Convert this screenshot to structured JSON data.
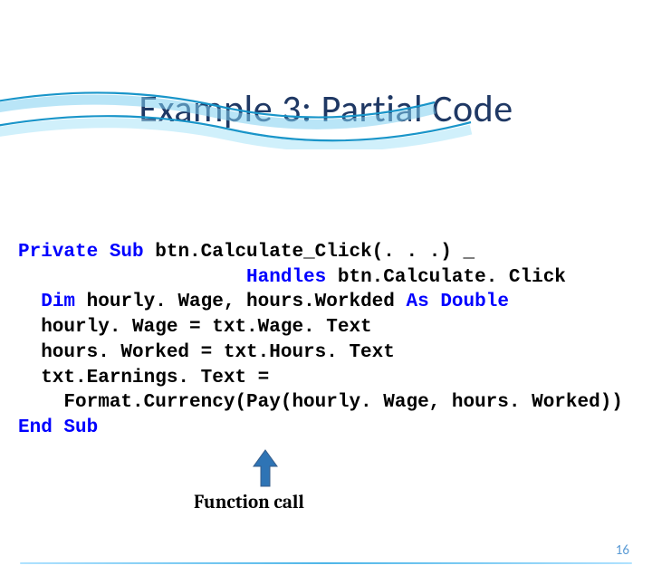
{
  "title": "Example 3: Partial Code",
  "code": {
    "k_private": "Private",
    "k_sub": "Sub",
    "sig1": " btn.Calculate_Click(. . .) _",
    "k_handles": "Handles",
    "sig2": " btn.Calculate. Click",
    "k_dim": "Dim",
    "vars1": " hourly. Wage, hours.Workded ",
    "k_as": "As",
    "k_double": " Double",
    "line4": "  hourly. Wage = txt.Wage. Text",
    "line5": "  hours. Worked = txt.Hours. Text",
    "line6": "  txt.Earnings. Text =",
    "line7": "    Format.Currency(Pay(hourly. Wage, hours. Worked))",
    "k_end": "End",
    "k_sub2": " Sub"
  },
  "label": "Function call",
  "page_number": "16"
}
